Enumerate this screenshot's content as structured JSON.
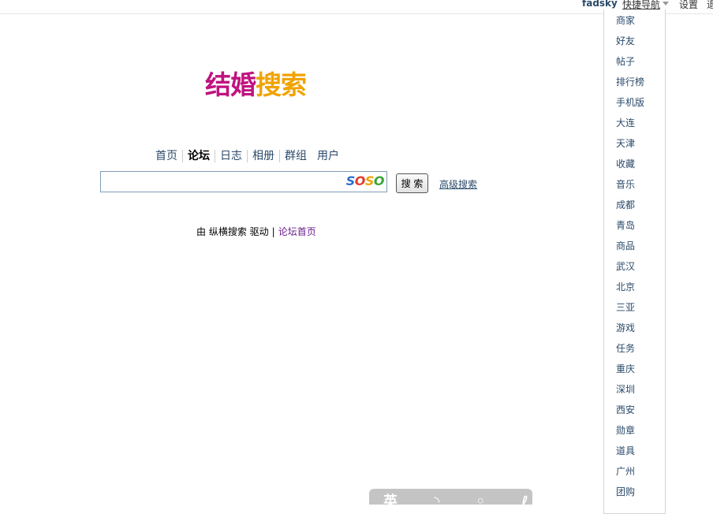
{
  "topbar": {
    "user": "fadsky",
    "quick_nav": "快捷导航",
    "settings": "设置",
    "more": "退"
  },
  "quick_nav_menu": {
    "items": [
      "商家",
      "好友",
      "帖子",
      "排行榜",
      "手机版",
      "大连",
      "天津",
      "收藏",
      "音乐",
      "成都",
      "青岛",
      "商品",
      "武汉",
      "北京",
      "三亚",
      "游戏",
      "任务",
      "重庆",
      "深圳",
      "西安",
      "勋章",
      "道具",
      "广州",
      "团购"
    ]
  },
  "logo": {
    "part1": "结婚",
    "part2": "搜索"
  },
  "nav": {
    "tabs": [
      {
        "label": "首页",
        "active": false
      },
      {
        "label": "论坛",
        "active": true
      },
      {
        "label": "日志",
        "active": false
      },
      {
        "label": "相册",
        "active": false
      },
      {
        "label": "群组",
        "active": false
      },
      {
        "label": "用户",
        "active": false
      }
    ]
  },
  "search": {
    "value": "",
    "engine_logo": {
      "s1": "S",
      "o1": "O",
      "s2": "S",
      "o2": "O"
    },
    "button_label": "搜 索",
    "advanced_label": "高级搜索"
  },
  "footer": {
    "powered_text": "由 纵横搜索 驱动",
    "separator": "|",
    "forum_home": "论坛首页"
  },
  "bottom_widget": {
    "glyphs": "英 ◝ ◦ ℓ"
  },
  "colors": {
    "logo_part1": "#c0127f",
    "logo_part2": "#f0a300",
    "link": "#2b4a6a"
  }
}
